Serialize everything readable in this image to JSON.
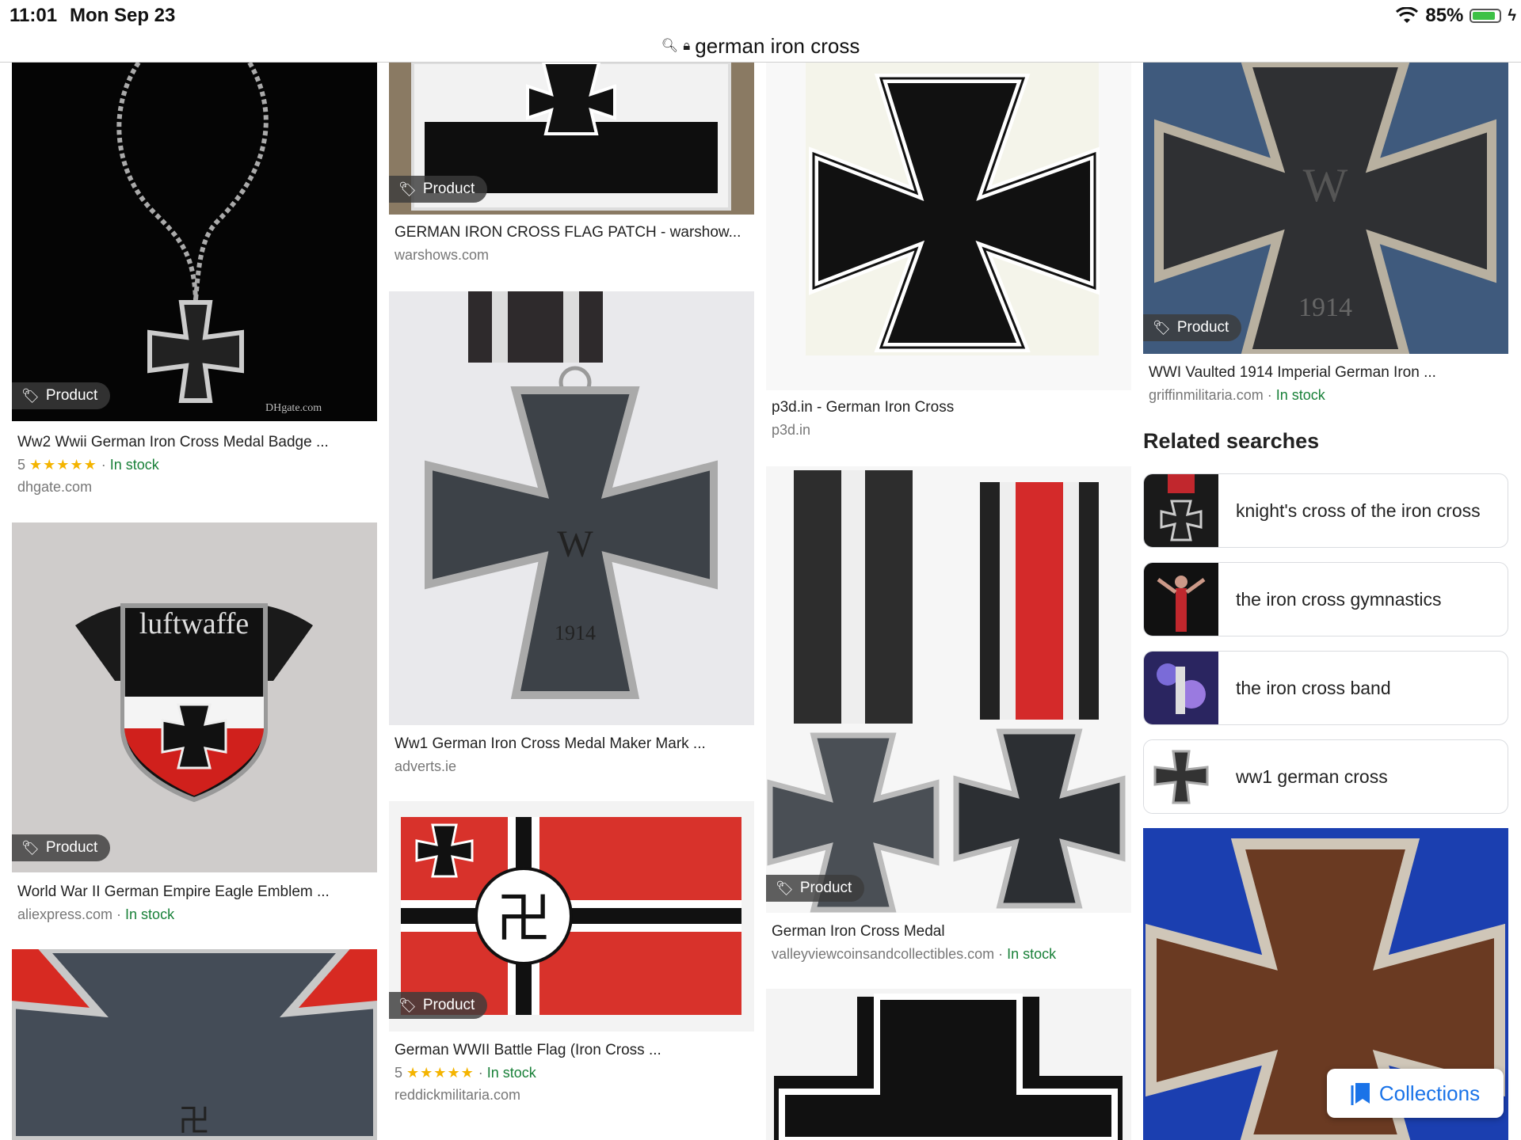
{
  "status": {
    "time": "11:01",
    "date": "Mon Sep 23",
    "battery": "85%",
    "battery_level": 0.85
  },
  "url": {
    "query": "german iron cross"
  },
  "product_tag": "Product",
  "col1": [
    {
      "title": "Ww2 Wwii German Iron Cross Medal Badge ...",
      "rating": "5",
      "stars": "★★★★★",
      "stock": "In stock",
      "source": "dhgate.com"
    },
    {
      "title": "World War II German Empire Eagle Emblem ...",
      "source": "aliexpress.com",
      "stock": "In stock"
    }
  ],
  "col2": [
    {
      "title": "GERMAN IRON CROSS FLAG PATCH - warshow...",
      "source": "warshows.com"
    },
    {
      "title": "Ww1 German Iron Cross Medal Maker Mark ...",
      "source": "adverts.ie"
    },
    {
      "title": "German WWII Battle Flag (Iron Cross ...",
      "rating": "5",
      "stars": "★★★★★",
      "stock": "In stock",
      "source": "reddickmilitaria.com"
    }
  ],
  "col3": [
    {
      "title": "p3d.in - German Iron Cross",
      "source": "p3d.in"
    },
    {
      "title": "German Iron Cross Medal",
      "source": "valleyviewcoinsandcollectibles.com",
      "stock": "In stock"
    }
  ],
  "col4": [
    {
      "title": "WWI Vaulted 1914 Imperial German Iron ...",
      "source": "griffinmilitaria.com",
      "stock": "In stock"
    }
  ],
  "img_text": {
    "luftwaffe": "luftwaffe",
    "w": "W",
    "year": "1914",
    "dh": "DHgate.com"
  },
  "related": {
    "heading": "Related searches",
    "items": [
      "knight's cross of the iron cross",
      "the iron cross gymnastics",
      "the iron cross band",
      "ww1 german cross"
    ]
  },
  "collections": "Collections"
}
